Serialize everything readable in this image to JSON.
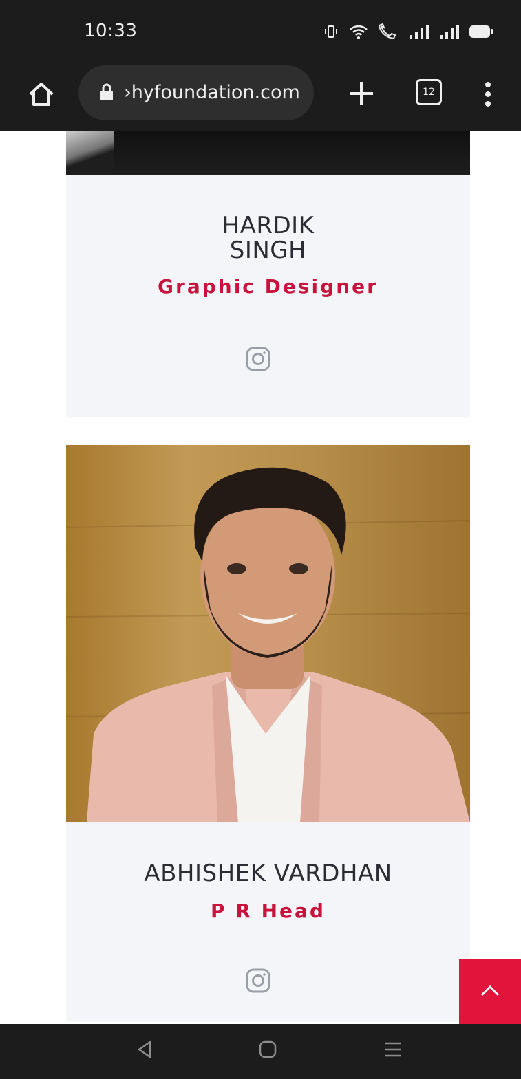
{
  "status_bar": {
    "time": "10:33",
    "icons": [
      "vibrate-icon",
      "wifi-icon",
      "volte-call-icon",
      "signal-icon",
      "signal-icon",
      "battery-icon"
    ]
  },
  "browser": {
    "url": "›hyfoundation.com",
    "tab_count": "12",
    "icons": [
      "home-icon",
      "lock-icon",
      "plus-icon",
      "tab-switcher-icon",
      "overflow-menu-icon"
    ]
  },
  "team": [
    {
      "name_line1": "HARDIK",
      "name_line2": "SINGH",
      "role": "Graphic Designer",
      "social": "instagram-icon"
    },
    {
      "name": "ABHISHEK VARDHAN",
      "role": "P R Head",
      "social": "instagram-icon"
    }
  ],
  "colors": {
    "accent": "#c8143c",
    "back_to_top": "#e3143c",
    "card_bg": "#f3f5f9",
    "bar_bg": "#1c1c1c"
  },
  "nav_bar": {
    "icons": [
      "back-icon",
      "home-icon",
      "recents-icon"
    ]
  }
}
